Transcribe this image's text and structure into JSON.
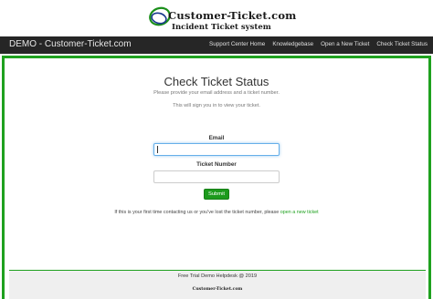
{
  "brand": {
    "logo_title": "Customer-Ticket.com",
    "logo_subtitle": "Incident Ticket system"
  },
  "navbar": {
    "brand": "DEMO - Customer-Ticket.com",
    "links": [
      "Support Center Home",
      "Knowledgebase",
      "Open a New Ticket",
      "Check Ticket Status"
    ]
  },
  "main": {
    "title": "Check Ticket Status",
    "subtitle_1": "Please provide your email address and a ticket number.",
    "subtitle_2": "This will sign you in to view your ticket.",
    "email_label": "Email",
    "email_value": "",
    "ticket_label": "Ticket Number",
    "ticket_value": "",
    "submit_label": "Submit",
    "help_text": "If this is your first time contacting us or you've lost the ticket number, please ",
    "help_link": "open a new ticket"
  },
  "footer": {
    "text": "Free Trial Demo Helpdesk @ 2019",
    "logo_text": "Customer-Ticket.com"
  },
  "colors": {
    "accent_green": "#1fa11f",
    "navbar_bg": "#262626"
  }
}
